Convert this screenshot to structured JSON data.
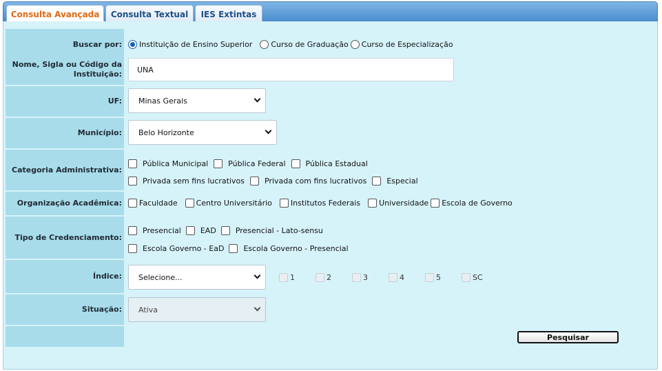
{
  "tabs": [
    "Consulta Avançada",
    "Consulta Textual",
    "IES Extintas"
  ],
  "buscar": {
    "label": "Buscar por:",
    "options": [
      "Instituição de Ensino Superior",
      "Curso de Graduação",
      "Curso de Especialização"
    ],
    "selected": 0
  },
  "nome": {
    "label": "Nome, Sigla ou Código da Instituição:",
    "value": "UNA"
  },
  "uf": {
    "label": "UF:",
    "value": "Minas Gerais"
  },
  "municipio": {
    "label": "Município:",
    "value": "Belo Horizonte"
  },
  "categoria": {
    "label": "Categoria Administrativa:",
    "options": [
      "Pública Municipal",
      "Pública Federal",
      "Pública Estadual",
      "Privada sem fins lucrativos",
      "Privada com fins lucrativos",
      "Especial"
    ]
  },
  "organizacao": {
    "label": "Organização Acadêmica:",
    "options": [
      "Faculdade",
      "Centro Universitário",
      "Institutos Federais",
      "Universidade",
      "Escola de Governo"
    ]
  },
  "credenciamento": {
    "label": "Tipo de Credenciamento:",
    "options": [
      "Presencial",
      "EAD",
      "Presencial - Lato-sensu",
      "Escola Governo - EaD",
      "Escola Governo - Presencial"
    ]
  },
  "indice": {
    "label": "Índice:",
    "value": "Selecione...",
    "options": [
      "1",
      "2",
      "3",
      "4",
      "5",
      "SC"
    ]
  },
  "situacao": {
    "label": "Situação:",
    "value": "Ativa"
  },
  "button": {
    "label": "Pesquisar"
  }
}
